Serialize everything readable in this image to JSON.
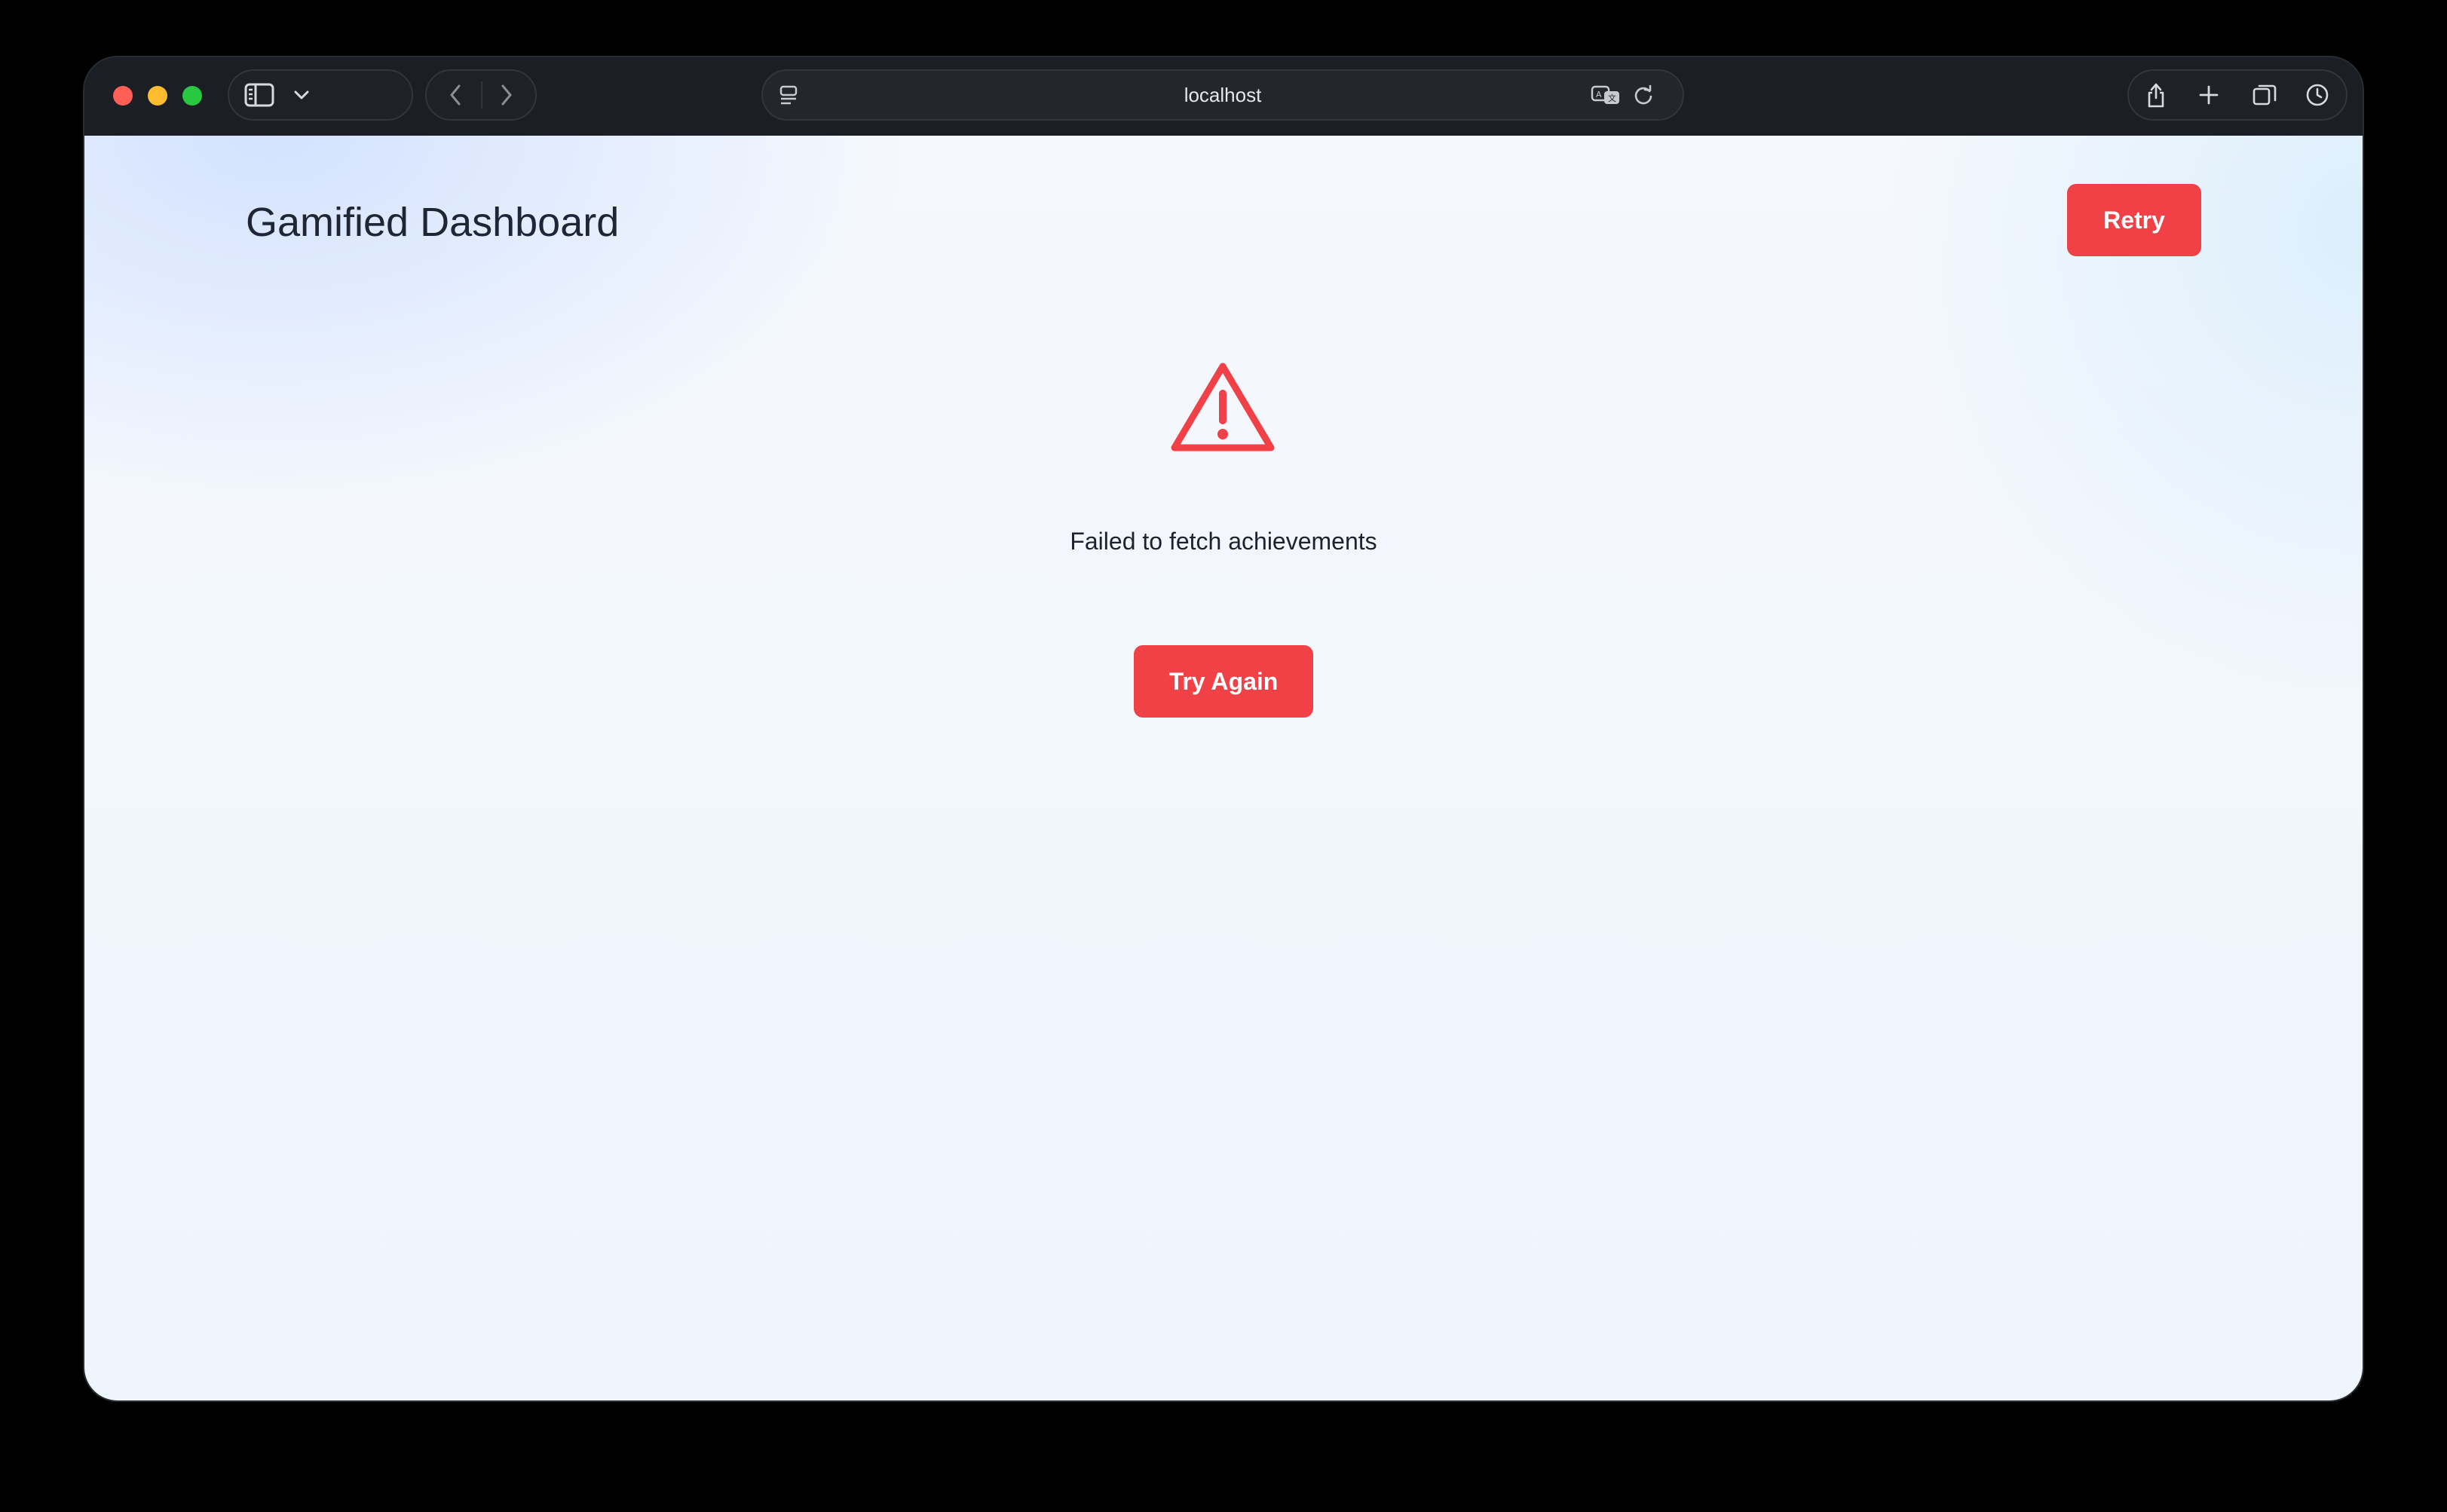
{
  "browser": {
    "url": "localhost",
    "colors": {
      "close": "#ff5f57",
      "minimize": "#febc2e",
      "zoom": "#28c840"
    },
    "icons": {
      "sidebar": "sidebar-icon",
      "chevron": "chevron-down-icon",
      "back": "back-arrow-icon",
      "forward": "forward-arrow-icon",
      "reader": "reader-mode-icon",
      "translate": "translate-icon",
      "reload": "reload-icon",
      "share": "share-icon",
      "new_tab": "plus-icon",
      "tabs": "tab-overview-icon",
      "history": "history-clock-icon"
    }
  },
  "header": {
    "title": "Gamified Dashboard",
    "retry_label": "Retry"
  },
  "error": {
    "icon": "warning-triangle-icon",
    "message": "Failed to fetch achievements",
    "try_again_label": "Try Again"
  },
  "theme": {
    "accent": "#ef4146",
    "title_color": "#1e2533"
  },
  "devtools": {
    "icon": "vue-devtools-icon"
  }
}
